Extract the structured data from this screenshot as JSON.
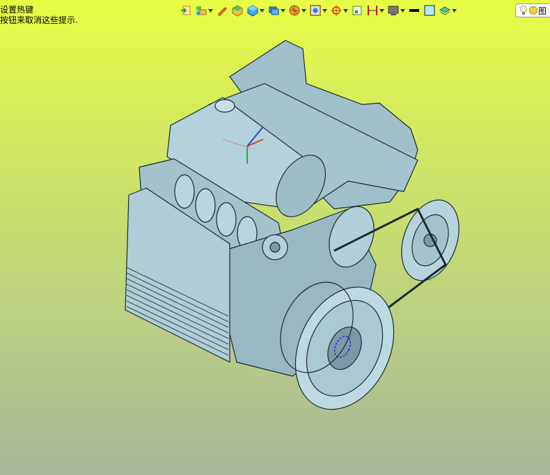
{
  "hint": {
    "line1": "设置热键",
    "line2": "按钮来取消这些提示."
  },
  "toolbar": {
    "icons": [
      "view-fit-icon",
      "render-mode-icon",
      "pencil-icon",
      "solid-box-icon",
      "blue-cube-icon",
      "stack-cube-icon",
      "section-pie-icon",
      "frame-box-icon",
      "target-icon",
      "small-square-icon",
      "dimension-icon",
      "monitor-icon",
      "black-bar-icon",
      "color-square-icon",
      "layers-icon"
    ],
    "light_box_text": "图"
  },
  "colors": {
    "model_fill": "#a9c9d3",
    "model_edge": "#1a2a30",
    "bg_top": "#e8ff45",
    "bg_bottom": "#a8b596",
    "axis_x": "#e0402a",
    "axis_y": "#2aa83a",
    "axis_z": "#2a40e0"
  }
}
